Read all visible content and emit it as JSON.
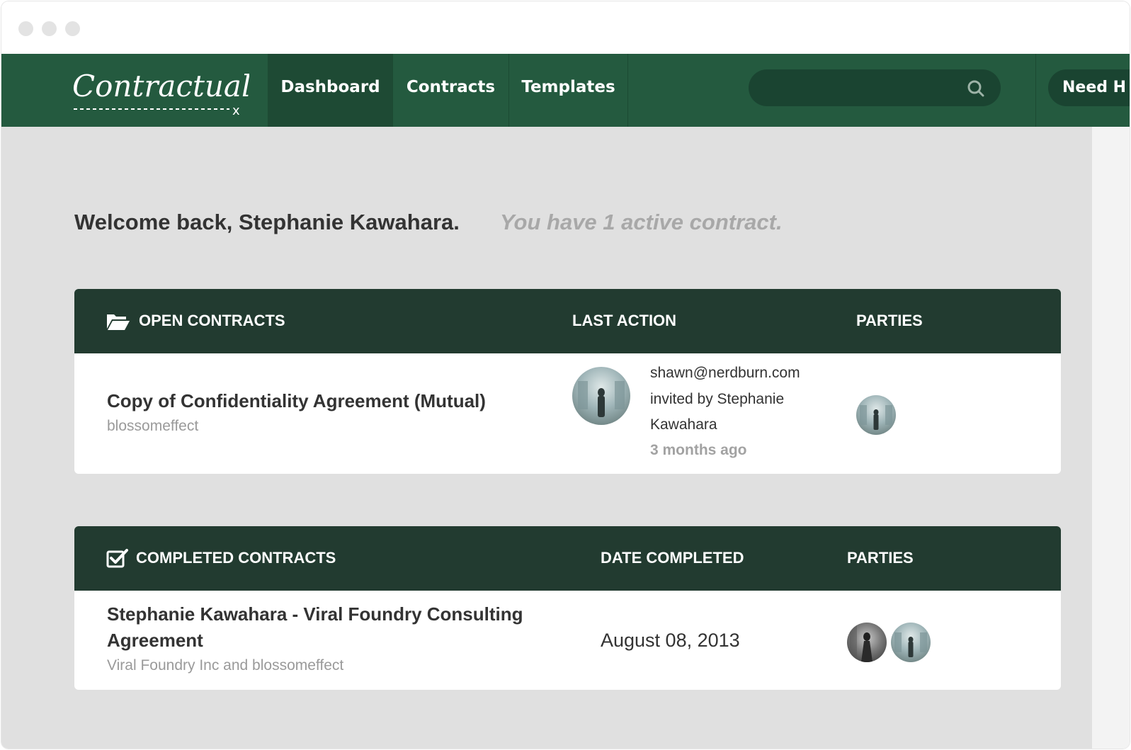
{
  "window": {
    "controls": [
      "close",
      "minimize",
      "maximize"
    ]
  },
  "nav": {
    "logo_text": "Contractually",
    "logo_mark": "x",
    "tabs": [
      {
        "label": "Dashboard",
        "active": true
      },
      {
        "label": "Contracts",
        "active": false
      },
      {
        "label": "Templates",
        "active": false
      }
    ],
    "search": {
      "placeholder": "",
      "icon": "search-icon"
    },
    "help_label": "Need H"
  },
  "welcome": {
    "greeting": "Welcome back, Stephanie Kawahara.",
    "status": "You have 1 active contract."
  },
  "open_contracts": {
    "icon": "folder-open-icon",
    "headers": {
      "title": "OPEN CONTRACTS",
      "last_action": "LAST ACTION",
      "parties": "PARTIES"
    },
    "rows": [
      {
        "title": "Copy of Confidentiality Agreement (Mutual)",
        "owner": "blossomeffect",
        "action_line1": "shawn@nerdburn.com",
        "action_line2": "invited by Stephanie",
        "action_line3": "Kawahara",
        "action_time": "3 months ago"
      }
    ]
  },
  "completed_contracts": {
    "icon": "checkbox-checked-icon",
    "headers": {
      "title": "COMPLETED CONTRACTS",
      "date": "DATE COMPLETED",
      "parties": "PARTIES"
    },
    "rows": [
      {
        "title_line1": "Stephanie Kawahara - Viral Foundry Consulting",
        "title_line2": "Agreement",
        "parties_text": "Viral Foundry Inc and blossomeffect",
        "date": "August 08, 2013"
      }
    ]
  },
  "colors": {
    "navbar": "#245a3f",
    "panel_header": "#223b30",
    "page_bg": "#e0e0e0"
  }
}
